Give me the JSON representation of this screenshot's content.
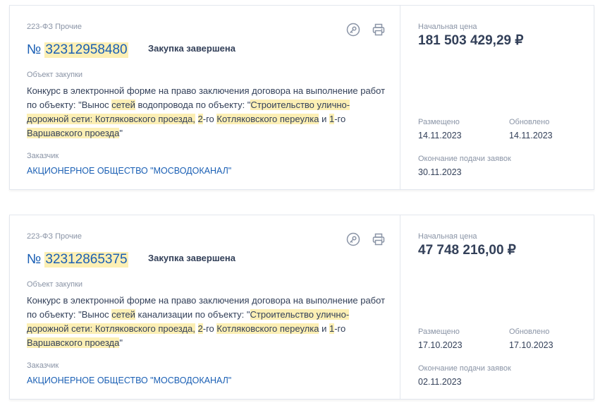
{
  "cards": [
    {
      "law": "223-ФЗ Прочие",
      "number_prefix": "№",
      "number": "32312958480",
      "status": "Закупка завершена",
      "object_label": "Объект закупки",
      "object_parts": [
        {
          "t": "Конкурс в электронной форме на право заключения договора на выполнение работ по объекту: \"Вынос "
        },
        {
          "t": "сетей",
          "hl": true
        },
        {
          "t": " водопровода по объекту: \""
        },
        {
          "t": "Строительство улично-дорожной сети: Котляковского проезда,",
          "hl": true
        },
        {
          "t": " "
        },
        {
          "t": "2",
          "hl": true
        },
        {
          "t": "-го "
        },
        {
          "t": "Котляковского переулка",
          "hl": true
        },
        {
          "t": " и "
        },
        {
          "t": "1",
          "hl": true
        },
        {
          "t": "-го "
        },
        {
          "t": "Варшавского проезда",
          "hl": true
        },
        {
          "t": "\""
        }
      ],
      "customer_label": "Заказчик",
      "customer": "АКЦИОНЕРНОЕ ОБЩЕСТВО \"МОСВОДОКАНАЛ\"",
      "price_label": "Начальная цена",
      "price": "181 503 429,29 ₽",
      "published_label": "Размещено",
      "published": "14.11.2023",
      "updated_label": "Обновлено",
      "updated": "14.11.2023",
      "end_label": "Окончание подачи заявок",
      "end": "30.11.2023"
    },
    {
      "law": "223-ФЗ Прочие",
      "number_prefix": "№",
      "number": "32312865375",
      "status": "Закупка завершена",
      "object_label": "Объект закупки",
      "object_parts": [
        {
          "t": "Конкурс в электронной форме на право заключения договора на выполнение работ по объекту: \"Вынос "
        },
        {
          "t": "сетей",
          "hl": true
        },
        {
          "t": " канализации по объекту: \""
        },
        {
          "t": "Строительство улично-дорожной сети: Котляковского проезда,",
          "hl": true
        },
        {
          "t": " "
        },
        {
          "t": "2",
          "hl": true
        },
        {
          "t": "-го "
        },
        {
          "t": "Котляковского переулка",
          "hl": true
        },
        {
          "t": " и "
        },
        {
          "t": "1",
          "hl": true
        },
        {
          "t": "-го "
        },
        {
          "t": "Варшавского проезда",
          "hl": true
        },
        {
          "t": "\""
        }
      ],
      "customer_label": "Заказчик",
      "customer": "АКЦИОНЕРНОЕ ОБЩЕСТВО \"МОСВОДОКАНАЛ\"",
      "price_label": "Начальная цена",
      "price": "47 748 216,00 ₽",
      "published_label": "Размещено",
      "published": "17.10.2023",
      "updated_label": "Обновлено",
      "updated": "17.10.2023",
      "end_label": "Окончание подачи заявок",
      "end": "02.11.2023"
    }
  ],
  "icons": {
    "key": "key-icon",
    "print": "print-icon"
  },
  "colors": {
    "link": "#1a5fb4",
    "highlight": "#fcefb4",
    "muted": "#8a94a6",
    "text": "#334059"
  }
}
